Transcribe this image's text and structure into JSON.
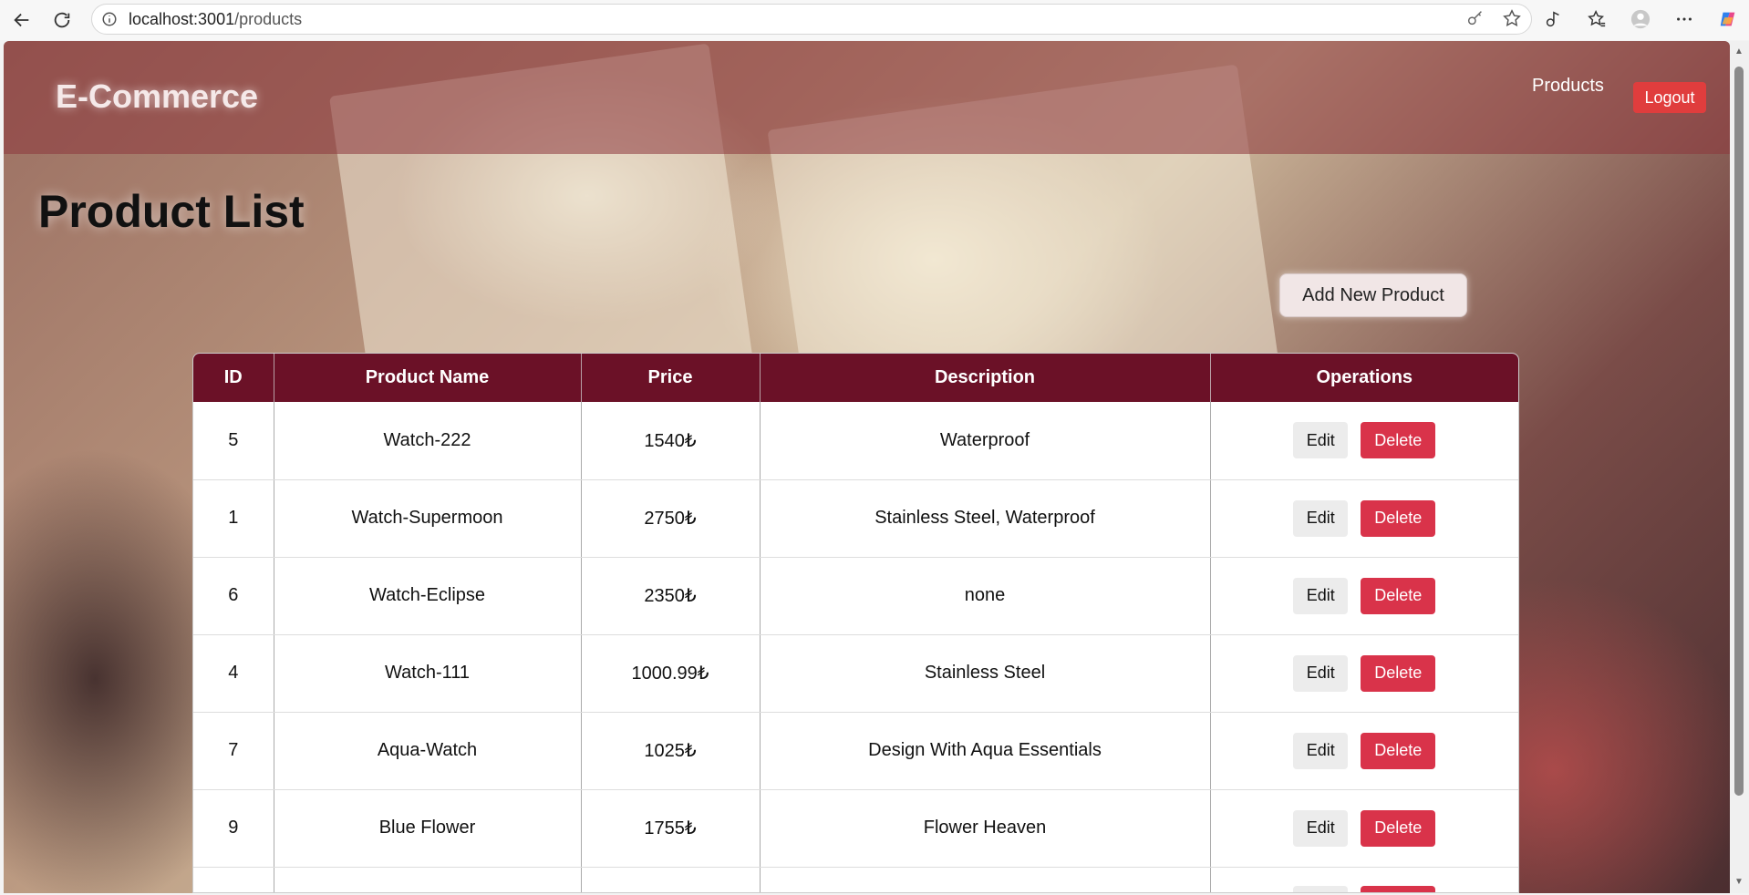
{
  "browser": {
    "url_host": "localhost:3001",
    "url_path": "/products"
  },
  "header": {
    "brand": "E-Commerce",
    "nav_products": "Products",
    "logout_label": "Logout"
  },
  "main": {
    "title": "Product List",
    "add_button": "Add New Product"
  },
  "table": {
    "columns": [
      "ID",
      "Product Name",
      "Price",
      "Description",
      "Operations"
    ],
    "rows": [
      {
        "id": "5",
        "name": "Watch-222",
        "price": "1540₺",
        "description": "Waterproof"
      },
      {
        "id": "1",
        "name": "Watch-Supermoon",
        "price": "2750₺",
        "description": "Stainless Steel, Waterproof"
      },
      {
        "id": "6",
        "name": "Watch-Eclipse",
        "price": "2350₺",
        "description": "none"
      },
      {
        "id": "4",
        "name": "Watch-111",
        "price": "1000.99₺",
        "description": "Stainless Steel"
      },
      {
        "id": "7",
        "name": "Aqua-Watch",
        "price": "1025₺",
        "description": "Design With Aqua Essentials"
      },
      {
        "id": "9",
        "name": "Blue Flower",
        "price": "1755₺",
        "description": "Flower Heaven"
      }
    ],
    "edit_label": "Edit",
    "delete_label": "Delete"
  },
  "colors": {
    "header_bg": "#8c373c",
    "table_header": "#6b1127",
    "delete_button": "#d9334a",
    "logout_button": "#e03d3d"
  },
  "icons": [
    "back-icon",
    "reload-icon",
    "info-icon",
    "key-icon",
    "star-icon",
    "extensions-icon",
    "favorites-icon",
    "profile-icon",
    "more-icon",
    "copilot-icon"
  ]
}
